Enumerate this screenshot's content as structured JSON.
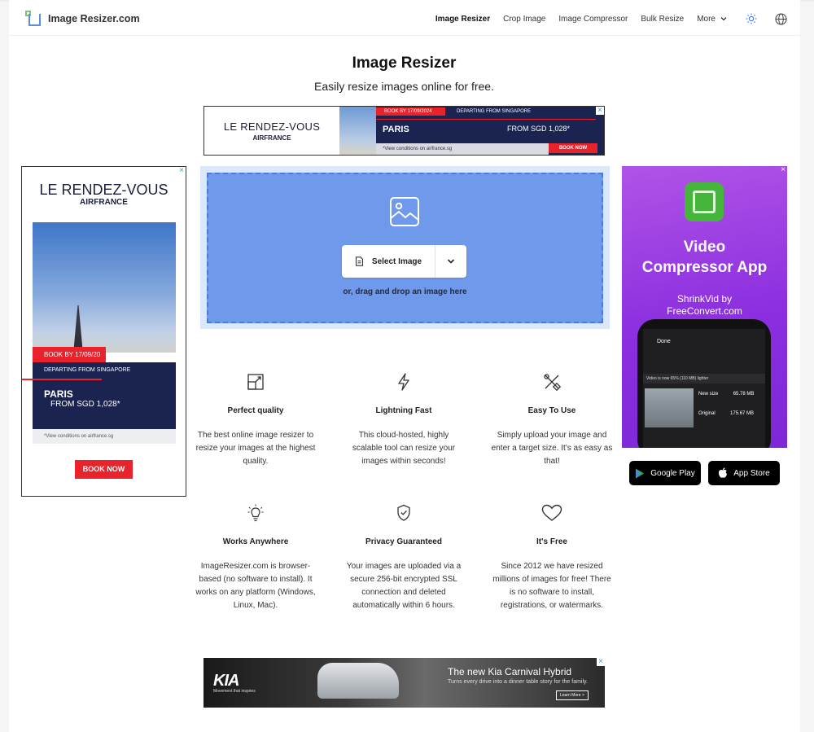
{
  "header": {
    "logo_text": "Image Resizer.com",
    "nav": [
      "Image Resizer",
      "Crop Image",
      "Image Compressor",
      "Bulk Resize"
    ],
    "more_label": "More",
    "icons": [
      "sun-icon",
      "globe-icon"
    ]
  },
  "hero": {
    "title": "Image Resizer",
    "subtitle": "Easily resize images online for free."
  },
  "uploader": {
    "select_label": "Select Image",
    "drop_hint": "or, drag and drop an image here"
  },
  "features": [
    {
      "icon": "resize-icon",
      "title": "Perfect quality",
      "desc": "The best online image resizer to resize your images at the highest quality."
    },
    {
      "icon": "lightning-icon",
      "title": "Lightning Fast",
      "desc": "This cloud-hosted, highly scalable tool can resize your images within seconds!"
    },
    {
      "icon": "tools-icon",
      "title": "Easy To Use",
      "desc": "Simply upload your image and enter a target size. It's as easy as that!"
    },
    {
      "icon": "lightbulb-icon",
      "title": "Works Anywhere",
      "desc": "ImageResizer.com is browser-based (no software to install). It works on any platform (Windows, Linux, Mac)."
    },
    {
      "icon": "shield-check-icon",
      "title": "Privacy Guaranteed",
      "desc": "Your images are uploaded via a secure 256-bit encrypted SSL connection and deleted automatically within 6 hours."
    },
    {
      "icon": "heart-icon",
      "title": "It's Free",
      "desc": "Since 2012 we have resized millions of images for free! There is no software to install, registrations, or watermarks."
    }
  ],
  "ads": {
    "airfrance_top": {
      "headline": "LE RENDEZ-VOUS",
      "brand": "AIRFRANCE",
      "book_by": "BOOK BY 17/09/2024",
      "departing": "DEPARTING FROM SINGAPORE",
      "city": "PARIS",
      "price": "FROM SGD 1,028*",
      "conditions": "*View conditions on airfrance.sg",
      "cta": "BOOK NOW"
    },
    "airfrance_left": {
      "headline": "LE RENDEZ-VOUS",
      "brand": "AIRFRANCE",
      "book_by": "BOOK BY 17/09/20",
      "departing": "DEPARTING FROM SINGAPORE",
      "city": "PARIS",
      "price": "FROM SGD 1,028*",
      "conditions": "*View conditions on airfrance.sg",
      "cta": "BOOK NOW"
    },
    "shrinkvid": {
      "title_line1": "Video",
      "title_line2": "Compressor App",
      "by_line1": "ShrinkVid by",
      "by_line2": "FreeConvert.com",
      "screen_done": "Done",
      "screen_bar": "Video is now 65% (110 MB) lighter",
      "new_size_label": "New size",
      "new_size_value": "65.78 MB",
      "original_label": "Original",
      "original_value": "175.67 MB",
      "google_play": "Google Play",
      "app_store": "App Store"
    },
    "kia": {
      "logo": "KIA",
      "tagline": "Movement that inspires",
      "headline": "The new Kia Carnival Hybrid",
      "sub": "Turns every drive into a dinner table story for the family.",
      "cta": "Learn More >"
    }
  },
  "colors": {
    "accent_blue": "#6f99ea",
    "drop_border": "#4e7ad6",
    "ad_red": "#e8232b",
    "ad_navy": "#1b2350",
    "ad_purple": "#8b2fe0"
  }
}
